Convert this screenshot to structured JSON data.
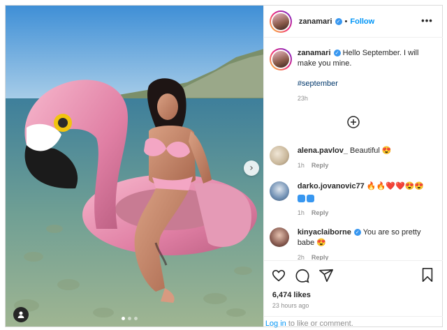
{
  "post": {
    "author": "zanamari",
    "follow_label": "Follow",
    "more_label": "•••",
    "caption_user": "zanamari",
    "caption_text": "Hello September. I will make you mine.",
    "hashtag": "#september",
    "caption_age": "23h",
    "likes": "6,474 likes",
    "posted_ago": "23 hours ago",
    "login_link": "Log in",
    "login_rest": " to like or comment."
  },
  "comments": [
    {
      "user": "alena.pavlov_",
      "text": "Beautiful 😍",
      "age": "1h",
      "reply": "Reply",
      "avatar_color": "#c9b79a"
    },
    {
      "user": "darko.jovanovic77",
      "text": "🔥🔥❤️❤️😍😍",
      "age": "1h",
      "reply": "Reply",
      "avatar_color": "#6f8fb3"
    },
    {
      "user": "kinyaclaiborne",
      "text": "You are so pretty babe 😍",
      "age": "2h",
      "reply": "Reply",
      "avatar_color": "#8a5d52"
    }
  ],
  "colors": {
    "accent": "#0095f6",
    "verified": "#3897f0",
    "muted": "#8e8e8e",
    "text": "#262626"
  },
  "icons": [
    "heart-icon",
    "comment-icon",
    "share-icon",
    "bookmark-icon",
    "add-comment-icon",
    "chevron-right-icon",
    "user-tag-icon",
    "verified-icon"
  ]
}
